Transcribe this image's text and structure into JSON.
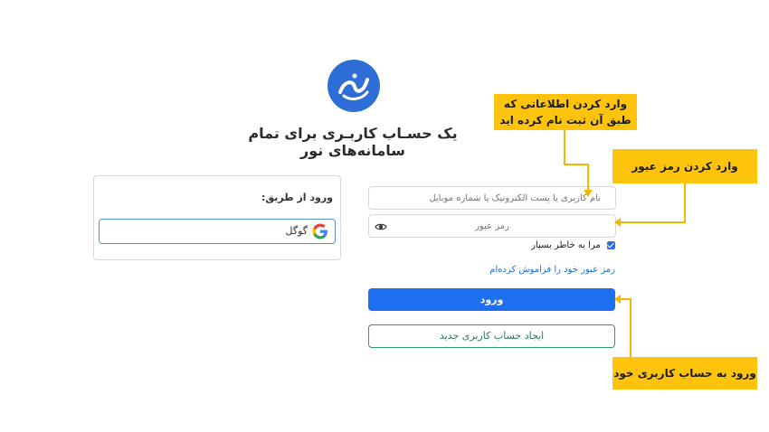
{
  "headline": "یک حسـاب کاربـری برای تمام سامانه‌های نور",
  "social": {
    "title": "ورود از طریق:",
    "google_label": "گوگل"
  },
  "form": {
    "username_placeholder": "نام کاربری یا پست الکترونیک یا شماره موبایل",
    "password_placeholder": "رمز عبور",
    "remember_label": "مرا به خاطر بسپار",
    "remember_checked": true,
    "forgot_label": "رمز عبور خود را فراموش کرده‌ام",
    "login_label": "ورود",
    "signup_label": "ایجاد حساب کاربری جدید"
  },
  "annotations": {
    "callout1_line1": "وارد کردن اطلاعاتی که",
    "callout1_line2": "طبق آن ثبت نام کرده اید",
    "callout2": "وارد کردن رمز عبور",
    "callout3": "ورود به حساب کاربری خود"
  },
  "colors": {
    "accent": "#1e6ff0",
    "callout": "#fec40c",
    "signup_border": "#2a9c6a",
    "logo_bg": "#2d6fd6"
  },
  "icons": [
    "noor-logo",
    "google-icon",
    "eye-icon",
    "checkbox-checked-icon"
  ]
}
